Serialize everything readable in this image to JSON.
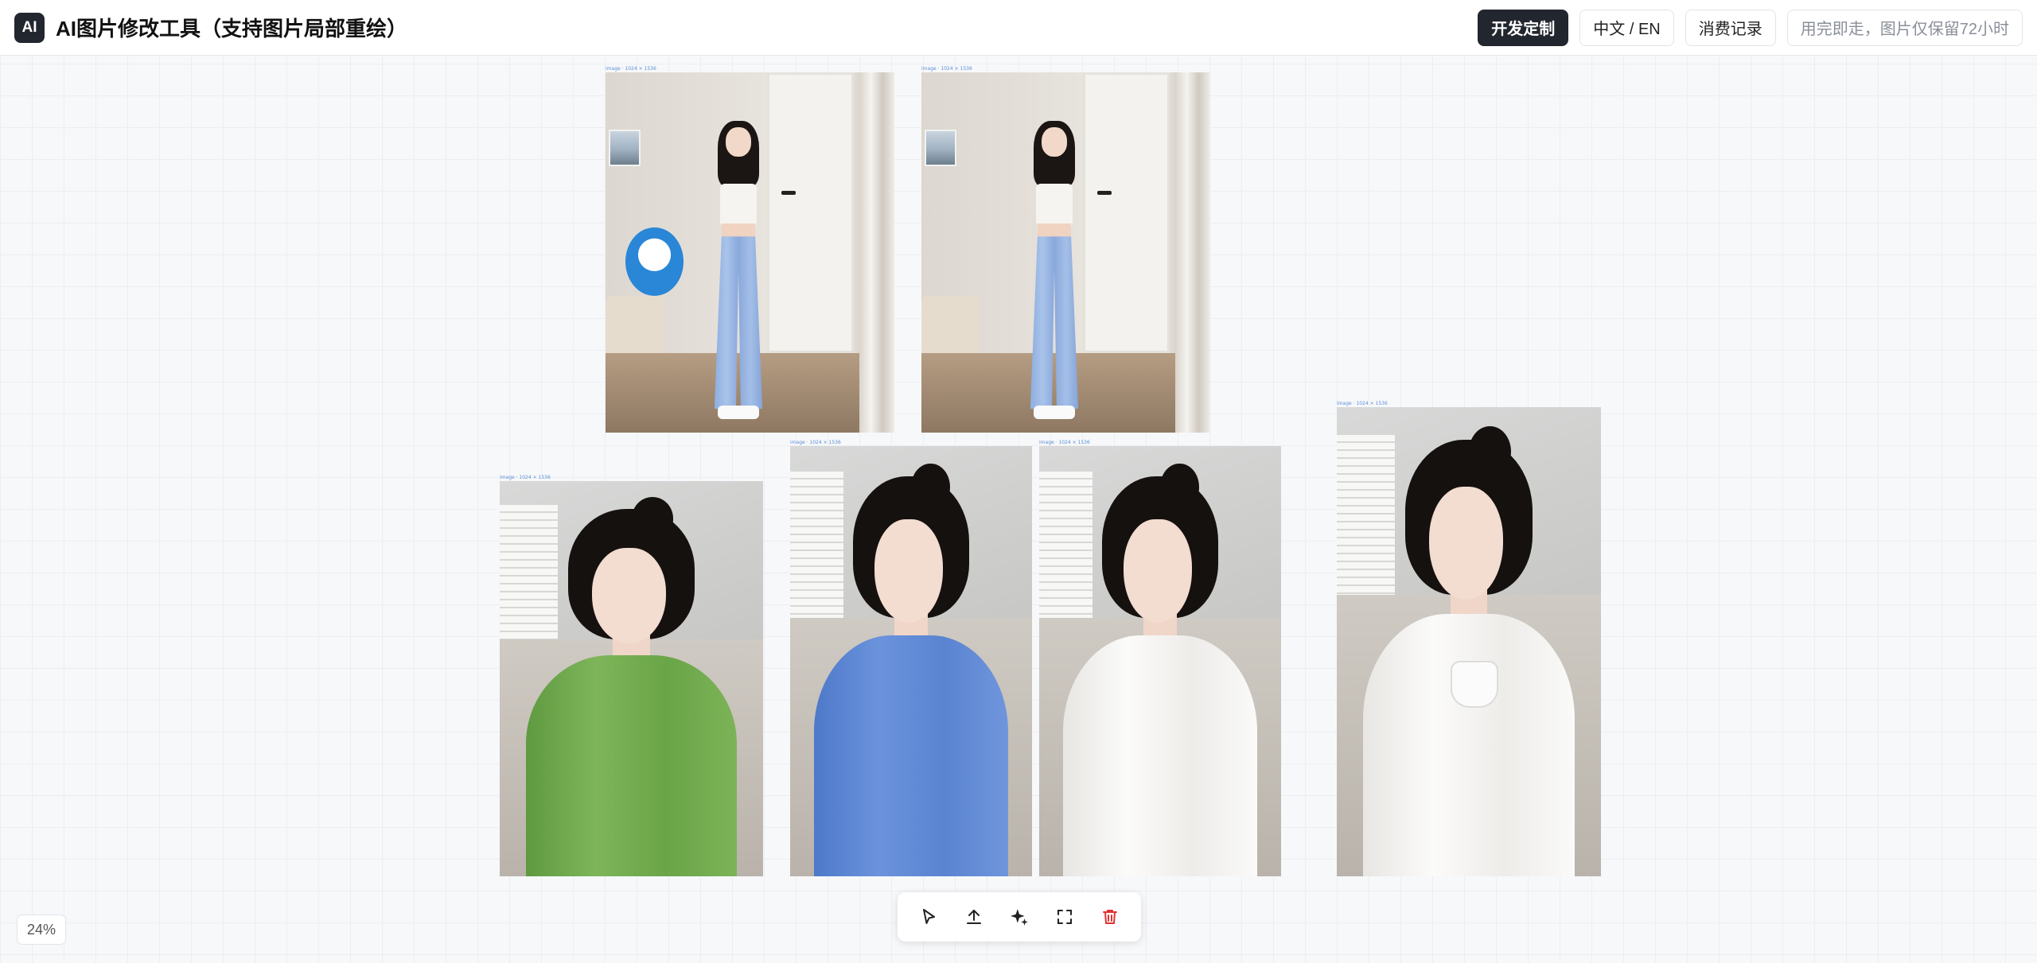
{
  "header": {
    "logo_text": "AI",
    "title": "AI图片修改工具（支持图片局部重绘）",
    "custom_dev_label": "开发定制",
    "language_label": "中文 / EN",
    "history_label": "消费记录",
    "retention_notice": "用完即走，图片仅保留72小时"
  },
  "canvas": {
    "zoom_label": "24%",
    "images": [
      {
        "label": "image · 1024 × 1536"
      },
      {
        "label": "image · 1024 × 1536"
      },
      {
        "label": "image · 1024 × 1536"
      },
      {
        "label": "image · 1024 × 1536"
      },
      {
        "label": "image · 1024 × 1536"
      },
      {
        "label": "image · 1024 × 1536"
      }
    ]
  },
  "toolbar": {
    "tools": [
      "select-icon",
      "upload-icon",
      "ai-edit-icon",
      "fit-screen-icon",
      "delete-icon"
    ],
    "delete_color": "#e03131"
  }
}
